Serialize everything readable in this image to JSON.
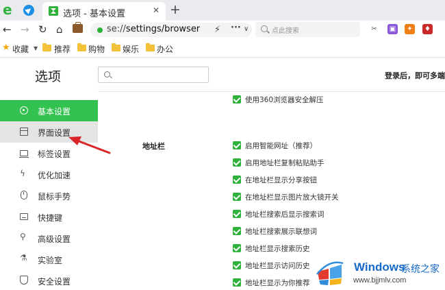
{
  "tabs": {
    "active_title": "选项 - 基本设置",
    "close_glyph": "✕",
    "new_tab_glyph": "+"
  },
  "nav": {
    "back_glyph": "←",
    "forward_glyph": "→",
    "reload_glyph": "↻",
    "home_glyph": "⌂",
    "url_prefix": "se://",
    "url_path": "settings/browser",
    "flash_glyph": "⚡",
    "more_glyph": "···",
    "dropdown_glyph": "∨",
    "search_placeholder": "点此搜索"
  },
  "extensions": [
    {
      "name": "scissors-icon",
      "glyph": "✂",
      "color": "#555555"
    },
    {
      "name": "purple-ext-icon",
      "glyph": "▣",
      "color": "#8b59d8"
    },
    {
      "name": "game-ext-icon",
      "glyph": "✦",
      "color": "#f07d16"
    },
    {
      "name": "red-ext-icon",
      "glyph": "♦",
      "color": "#c92b2b"
    },
    {
      "name": "pocket-ext-icon",
      "glyph": "◘",
      "color": "#444444"
    },
    {
      "name": "green-ext-icon",
      "glyph": "■",
      "color": "#2fb23c"
    }
  ],
  "bookmarks": {
    "favorites_label": "收藏",
    "arrow_glyph": "▼",
    "items": [
      "推荐",
      "购物",
      "娱乐",
      "办公"
    ]
  },
  "settings": {
    "page_title": "选项",
    "login_hint": "登录后，即可多端",
    "sidebar": [
      {
        "label": "基本设置",
        "icon": "settings-icon"
      },
      {
        "label": "界面设置",
        "icon": "window-icon"
      },
      {
        "label": "标签设置",
        "icon": "tab-icon"
      },
      {
        "label": "优化加速",
        "icon": "bolt-icon",
        "glyph": "ϟ"
      },
      {
        "label": "鼠标手势",
        "icon": "mouse-icon"
      },
      {
        "label": "快捷键",
        "icon": "keyboard-icon"
      },
      {
        "label": "高级设置",
        "icon": "wrench-icon",
        "glyph": "⚲"
      },
      {
        "label": "实验室",
        "icon": "flask-icon",
        "glyph": "⚗"
      },
      {
        "label": "安全设置",
        "icon": "shield-icon"
      }
    ],
    "top_option": "使用360浏览器安全解压",
    "section_label": "地址栏",
    "address_options": [
      "启用智能网址（推荐）",
      "启用地址栏复制粘贴助手",
      "在地址栏显示分享按钮",
      "在地址栏显示图片放大镜开关",
      "地址栏搜索后显示搜索词",
      "地址栏搜索展示联想词",
      "地址栏显示搜索历史",
      "地址栏显示访问历史",
      "地址栏显示为你推荐"
    ]
  },
  "watermark": {
    "brand": "Windows",
    "sub": "系统之家",
    "url": "www.bjjmlv.com"
  },
  "colors": {
    "accent": "#33c14f",
    "annotation": "#d9262b"
  }
}
